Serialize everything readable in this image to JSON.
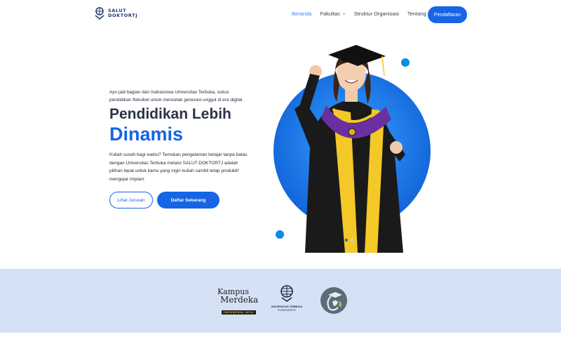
{
  "brand": {
    "line1": "SALUT",
    "line2": "DOKTORTJ"
  },
  "nav": {
    "items": [
      {
        "label": "Beranda",
        "active": true,
        "dropdown": false
      },
      {
        "label": "Fakultas",
        "active": false,
        "dropdown": true
      },
      {
        "label": "Struktur Organisasi",
        "active": false,
        "dropdown": false
      },
      {
        "label": "Tentang",
        "active": false,
        "dropdown": true
      }
    ],
    "cta_label": "Pendaftaran"
  },
  "hero": {
    "eyebrow": "Ayo jadi bagian dari mahasiswa Universitas Terbuka, solusi pendidikan fleksibel untuk mencetak generasi unggul di era digital.",
    "title_line1": "Pendidikan Lebih",
    "title_line2": "Dinamis",
    "description": "Kuliah susah bagi waktu? Temukan pengalaman belajar tanpa batas dengan Universitas Terbuka melalui SALUT DOKTORTJ adalah pilihan tepat untuk kamu yang ingin kuliah sambil tetap produktif mengejar impian!",
    "btn_secondary": "Lihat Jurusan",
    "btn_primary": "Daftar Sekarang",
    "slider": {
      "count": 2,
      "active": 1
    }
  },
  "partners": {
    "kampus_merdeka": {
      "line1": "Kampus",
      "line2": "Merdeka",
      "tag": "INDONESIA JAYA"
    },
    "ut": {
      "title": "UNIVERSITAS TERBUKA",
      "subtitle": "PURWOKERTO"
    }
  },
  "colors": {
    "primary": "#1565e6",
    "accent_dot": "#0d8ce6",
    "band": "#d5e1f5",
    "heading": "#2c3347"
  }
}
